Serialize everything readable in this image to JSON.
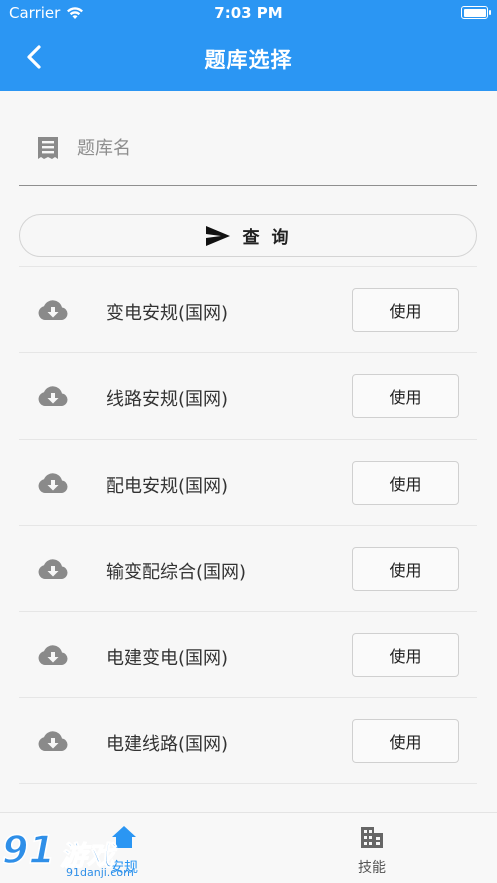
{
  "status_bar": {
    "carrier": "Carrier",
    "time": "7:03 PM"
  },
  "header": {
    "title": "题库选择"
  },
  "search": {
    "placeholder": "题库名",
    "value": ""
  },
  "query_button": {
    "label": "查 询"
  },
  "banks": [
    {
      "name": "变电安规(国网)",
      "action": "使用"
    },
    {
      "name": "线路安规(国网)",
      "action": "使用"
    },
    {
      "name": "配电安规(国网)",
      "action": "使用"
    },
    {
      "name": "输变配综合(国网)",
      "action": "使用"
    },
    {
      "name": "电建变电(国网)",
      "action": "使用"
    },
    {
      "name": "电建线路(国网)",
      "action": "使用"
    }
  ],
  "bottom_nav": {
    "tabs": [
      {
        "label": "安规",
        "icon": "home-icon",
        "active": true
      },
      {
        "label": "技能",
        "icon": "building-icon",
        "active": false
      }
    ]
  },
  "watermark": {
    "brand": "91",
    "brand_cn": "游戏",
    "url": "91danji.com"
  },
  "colors": {
    "primary": "#2b96f3",
    "background": "#f7f7f7",
    "icon_gray": "#8a8a8a"
  }
}
